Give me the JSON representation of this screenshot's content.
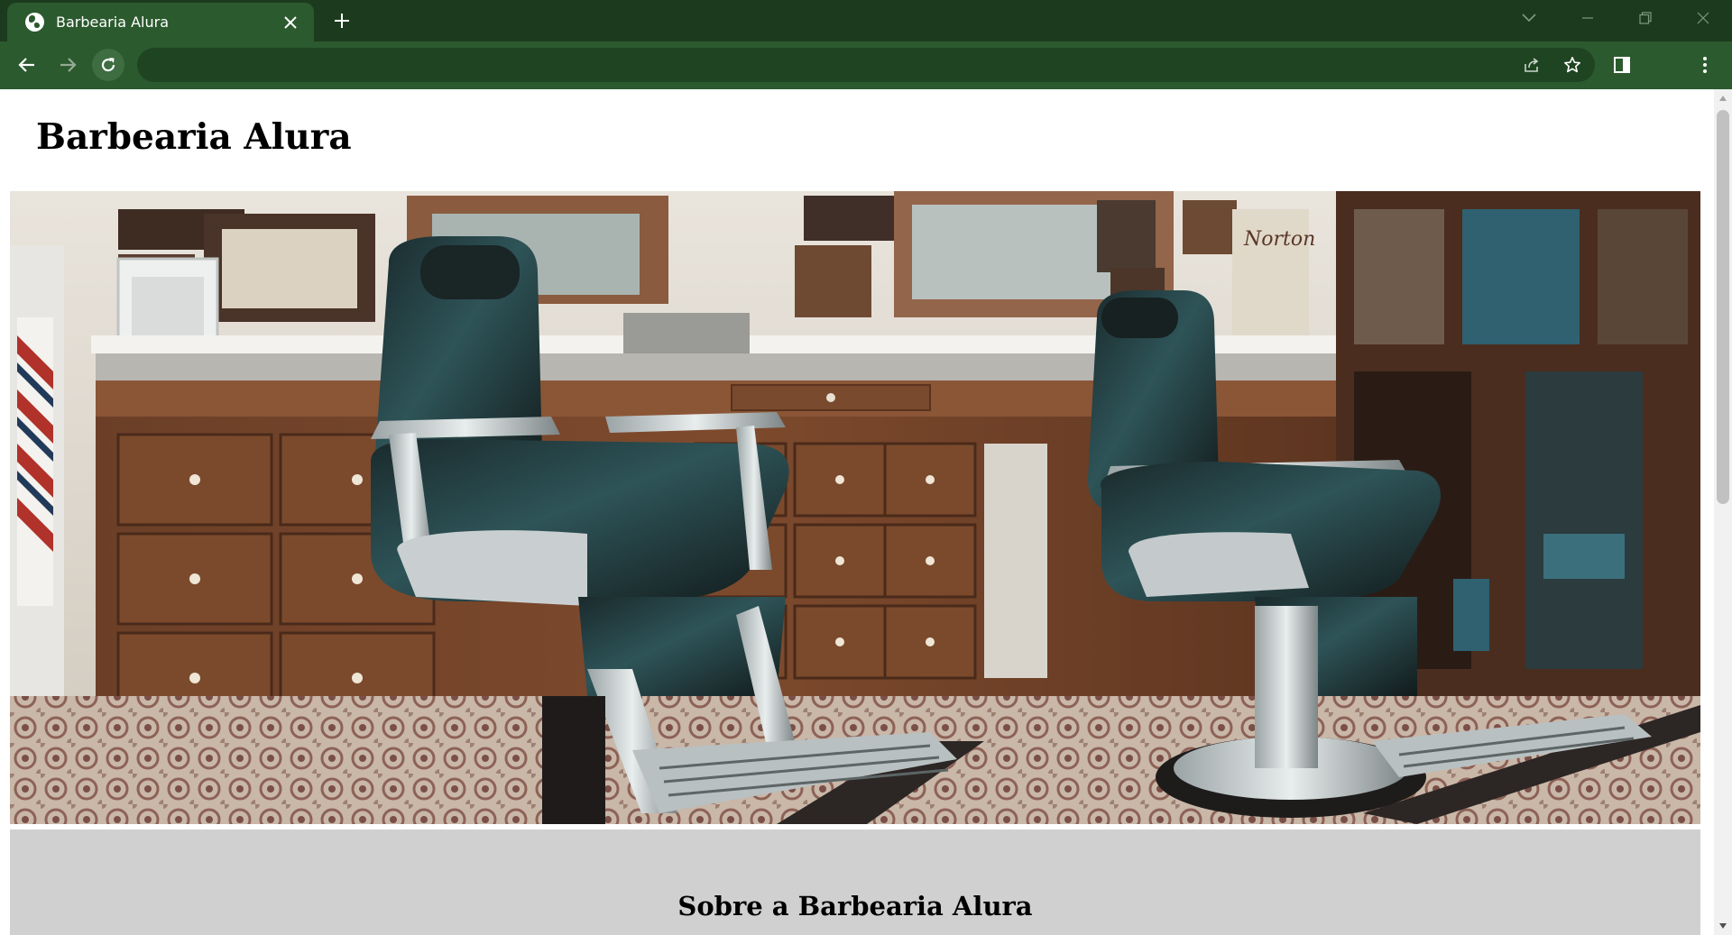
{
  "browser": {
    "tab": {
      "title": "Barbearia Alura",
      "favicon": "globe-icon",
      "close_icon": "close-icon"
    },
    "new_tab_icon": "plus-icon",
    "tab_search_icon": "chevron-down-icon",
    "window_controls": [
      "minimize-icon",
      "restore-icon",
      "close-icon"
    ],
    "toolbar": {
      "back_icon": "arrow-left-icon",
      "forward_icon": "arrow-right-icon",
      "reload_icon": "reload-icon",
      "address": "",
      "share_icon": "share-icon",
      "bookmark_icon": "star-icon",
      "side_panel_icon": "side-panel-icon",
      "menu_icon": "kebab-menu-icon"
    },
    "colors": {
      "tabstrip": "#1c3b1e",
      "toolbar": "#2b5a2e",
      "omnibox": "#1f4422"
    }
  },
  "page": {
    "title": "Barbearia Alura",
    "hero_image": "barbershop-interior-photo",
    "about": {
      "heading": "Sobre a Barbearia Alura",
      "background": "#d0d0d0"
    }
  },
  "scrollbar": {
    "position": 0
  }
}
